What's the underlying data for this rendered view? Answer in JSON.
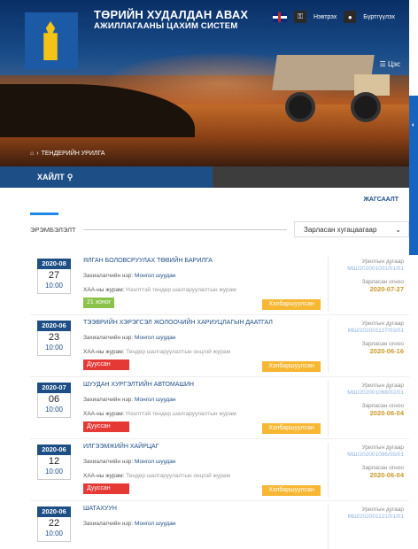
{
  "header": {
    "title_line1": "ТӨРИЙН ХУДАЛДАН АВАХ",
    "title_line2": "АЖИЛЛАГААНЫ ЦАХИМ СИСТЕМ",
    "login": "Нэвтрэх",
    "register": "Бүртгүүлэх",
    "menu": "Цэс",
    "breadcrumb": "ТЕНДЕРИЙН УРИЛГА"
  },
  "search": {
    "tab_label": "ХАЙЛТ"
  },
  "toolbar": {
    "sort_link": "ЖАГСААЛТ",
    "filter_label": "ЭРЭМБЭЛЭЛТ",
    "sort_select": "Зарласан хугацаагаар"
  },
  "labels": {
    "customer": "Захиалагчийн нэр:",
    "type": "ХАА-ны журам:",
    "invite_no": "Урилгын дугаар",
    "announced": "Зарласан огноо"
  },
  "tenders": [
    {
      "ym": "2020-08",
      "day": "27",
      "time": "10:00",
      "title": "ЯЛГАН БОЛОВСРУУЛАХ ТӨВИЙН БАРИЛГА",
      "customer": "Монгол шуудан",
      "type": "Нээлттэй тендер шалгаруулалтын журам",
      "status": "21 хоног",
      "progress": "Хэлбаршуулсан",
      "code": "МШ/202001001/01/01",
      "date": "2020-07-27"
    },
    {
      "ym": "2020-06",
      "day": "23",
      "time": "10:00",
      "title": "ТЭЭВРИЙН ХЭРЭГСЭЛ ЖОЛООЧИЙН ХАРИУЦЛАГЫН ДААТГАЛ",
      "customer": "Монгол шуудан",
      "type": "Тендер шалгаруулалтын онцгой журам",
      "status": "Дууссан",
      "progress": "Хэлбаршуулсан",
      "code": "МШ/202001127/03/01",
      "date": "2020-06-16"
    },
    {
      "ym": "2020-07",
      "day": "06",
      "time": "10:00",
      "title": "ШУУДАН ХУРГЭЛТИЙН АВТОМАШИН",
      "customer": "Монгол шуудан",
      "type": "Нээлттэй тендер шалгаруулалтын журам",
      "status": "Дууссан",
      "progress": "Хэлбаршуулсан",
      "code": "МШ/202001068/02/01",
      "date": "2020-06-04"
    },
    {
      "ym": "2020-06",
      "day": "12",
      "time": "10:00",
      "title": "ИЛГЭЭМЖИЙН ХАЙРЦАГ",
      "customer": "Монгол шуудан",
      "type": "Тендер шалгаруулалтын онцгой журам",
      "status": "Дууссан",
      "progress": "Хэлбаршуулсан",
      "code": "МШ/202001086/05/01",
      "date": "2020-06-04"
    },
    {
      "ym": "2020-06",
      "day": "22",
      "time": "10:00",
      "title": "ШАТАХУУН",
      "customer": "Монгол шуудан",
      "type": "",
      "status": "",
      "progress": "",
      "code": "МШ/202001121/01/01",
      "date": ""
    }
  ]
}
